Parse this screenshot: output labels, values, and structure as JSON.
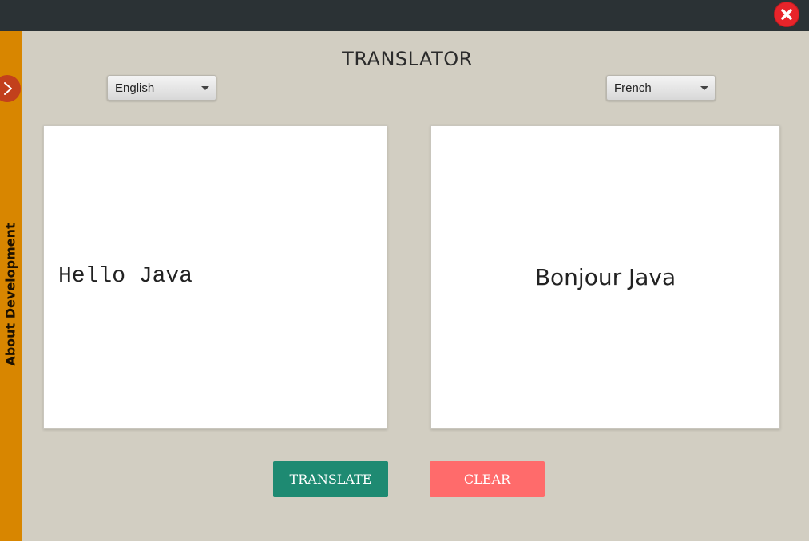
{
  "app": {
    "title": "TRANSLATOR"
  },
  "window": {
    "close_icon": "close-icon"
  },
  "sidebar": {
    "label": "About Development",
    "toggle_icon": "chevron-right-icon"
  },
  "source": {
    "language": "English",
    "text": "Hello Java"
  },
  "target": {
    "language": "French",
    "text": "Bonjour Java"
  },
  "actions": {
    "translate_label": "TRANSLATE",
    "clear_label": "CLEAR"
  },
  "colors": {
    "titlebar": "#2b3235",
    "background": "#d2cec2",
    "sidebar": "#d88600",
    "sidebar_toggle": "#c2401c",
    "close": "#e8242a",
    "translate": "#1e8a72",
    "clear": "#ff6b6b"
  }
}
